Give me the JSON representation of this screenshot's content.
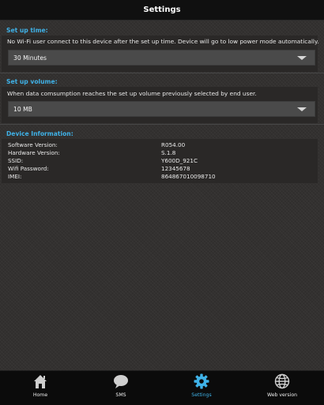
{
  "header": {
    "title": "Settings"
  },
  "setup_time": {
    "label": "Set up time:",
    "description": "No Wi-Fi user connect to this device after the set up time. Device will go to low power mode automatically.",
    "selected": "30 Minutes"
  },
  "setup_volume": {
    "label": "Set up volume:",
    "description": "When data comsumption reaches the set up volume previously selected by end user.",
    "selected": "10 MB"
  },
  "device_info": {
    "label": "Device Information:",
    "rows": [
      {
        "key": "Software Version:",
        "value": "R054.00"
      },
      {
        "key": "Hardware Version:",
        "value": "S.1.8"
      },
      {
        "key": "SSID:",
        "value": "Y600D_921C"
      },
      {
        "key": "Wifi Password:",
        "value": "12345678"
      },
      {
        "key": "IMEI:",
        "value": "864867010098710"
      }
    ]
  },
  "nav": [
    {
      "label": "Home",
      "icon": "home-icon"
    },
    {
      "label": "SMS",
      "icon": "chat-bubble-icon"
    },
    {
      "label": "Settings",
      "icon": "gear-icon",
      "active": true
    },
    {
      "label": "Web version",
      "icon": "globe-icon"
    }
  ],
  "colors": {
    "accent": "#3fb2e8",
    "background": "#333130",
    "titlebar": "#101010",
    "navbar": "#0b0b0b"
  }
}
